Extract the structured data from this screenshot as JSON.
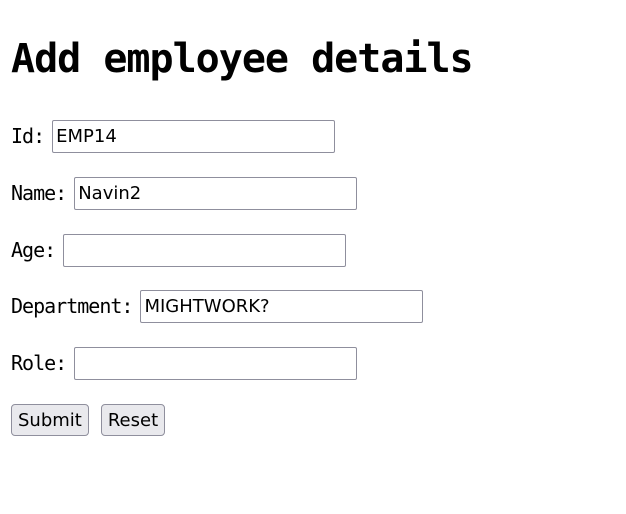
{
  "page": {
    "title": "Add employee details"
  },
  "form": {
    "fields": [
      {
        "key": "id",
        "label": "Id:",
        "value": "EMP14",
        "placeholder": ""
      },
      {
        "key": "name",
        "label": "Name:",
        "value": "Navin2",
        "placeholder": ""
      },
      {
        "key": "age",
        "label": "Age:",
        "value": "",
        "placeholder": ""
      },
      {
        "key": "department",
        "label": "Department:",
        "value": "MIGHTWORK?",
        "placeholder": ""
      },
      {
        "key": "role",
        "label": "Role:",
        "value": "",
        "placeholder": ""
      }
    ],
    "submit_label": "Submit",
    "reset_label": "Reset"
  }
}
